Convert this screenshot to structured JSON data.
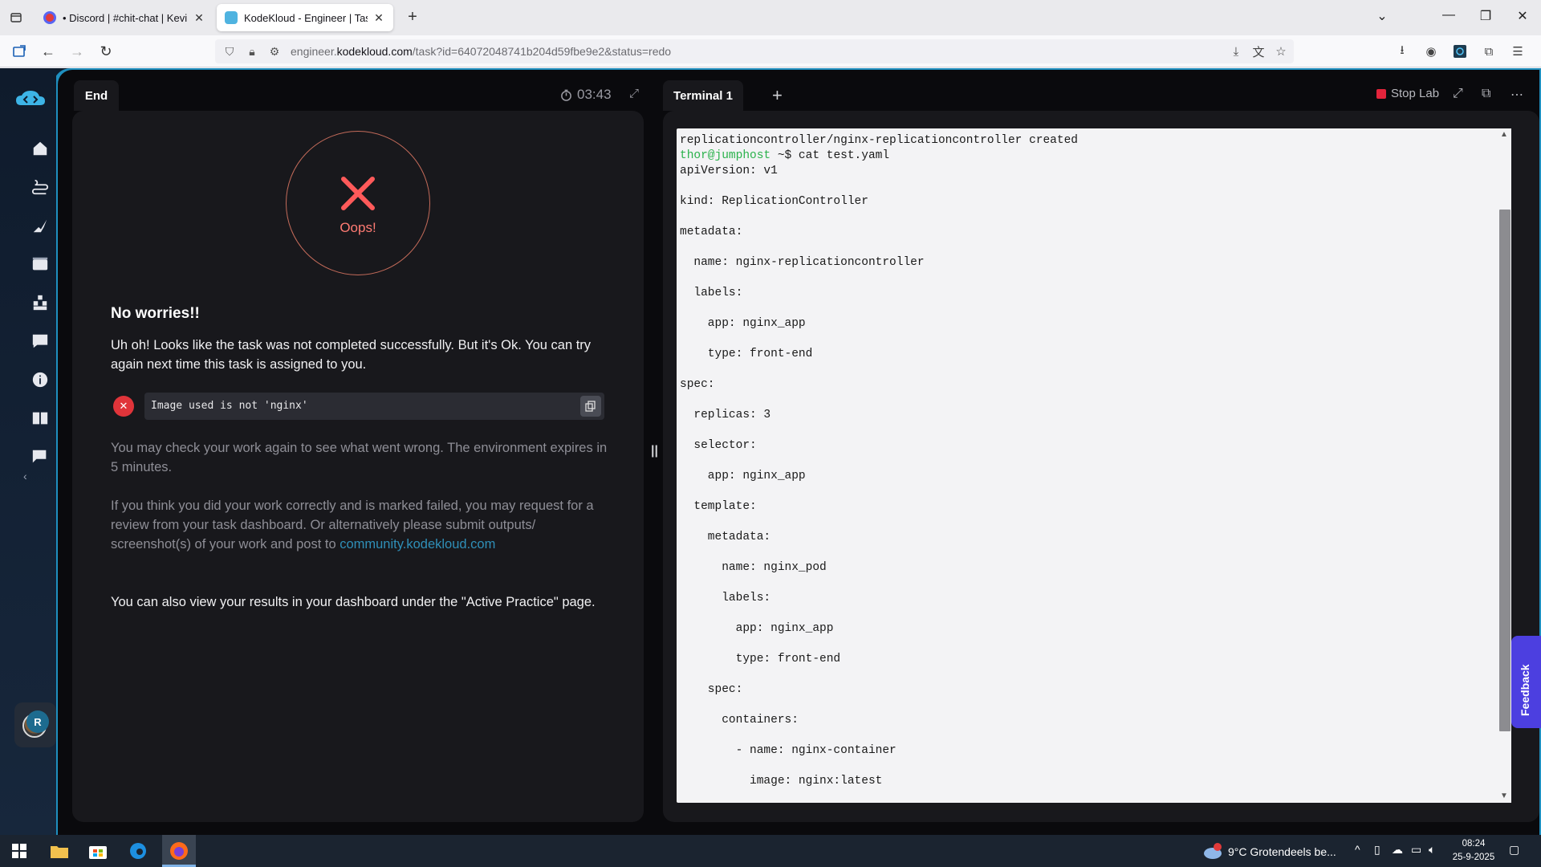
{
  "browser": {
    "tabs": [
      {
        "title": "• Discord | #chit-chat | Kevin Po",
        "active": false
      },
      {
        "title": "KodeKloud - Engineer | Task",
        "active": true
      }
    ],
    "url_prefix": "engineer.",
    "url_domain": "kodekloud.com",
    "url_path": "/task?id=64072048741b204d59fbe9e2&status=redo"
  },
  "left_panel": {
    "tab_label": "End",
    "timer": "03:43",
    "oops_label": "Oops!",
    "heading": "No worries!!",
    "message": "Uh oh! Looks like the task was not completed successfully. But it's Ok. You can try again next time this task is assigned to you.",
    "error_text": "Image used is not 'nginx'",
    "check_text": "You may check your work again to see what went wrong. The environment expires in 5 minutes.",
    "review_text": "If you think you did your work correctly and is marked failed, you may request for a review from your task dashboard. Or alternatively please submit outputs/ screenshot(s) of your work and post to ",
    "review_link": "community.kodekloud.com",
    "results_text": "You can also view your results in your dashboard under the \"Active Practice\" page."
  },
  "terminal": {
    "tab_label": "Terminal 1",
    "stop_label": "Stop Lab",
    "prompt_user": "thor@jumphost",
    "prompt_rest": " ~$ cat test.yaml",
    "lines": [
      "replicationcontroller/nginx-replicationcontroller created",
      "__PROMPT__",
      "apiVersion: v1",
      "",
      "kind: ReplicationController",
      "",
      "metadata:",
      "",
      "  name: nginx-replicationcontroller",
      "",
      "  labels:",
      "",
      "    app: nginx_app",
      "",
      "    type: front-end",
      "",
      "spec:",
      "",
      "  replicas: 3",
      "",
      "  selector:",
      "",
      "    app: nginx_app",
      "",
      "  template:",
      "",
      "    metadata:",
      "",
      "      name: nginx_pod",
      "",
      "      labels:",
      "",
      "        app: nginx_app",
      "",
      "        type: front-end",
      "",
      "    spec:",
      "",
      "      containers:",
      "",
      "        - name: nginx-container",
      "",
      "          image: nginx:latest"
    ]
  },
  "feedback_label": "Feedback",
  "sidebar": {
    "user_initial": "R",
    "icons": [
      "home-icon",
      "learning-path-icon",
      "playground-icon",
      "video-icon",
      "skills-icon",
      "forum-icon",
      "info-icon",
      "docs-icon",
      "chat-icon"
    ]
  },
  "taskbar": {
    "weather": "9°C  Grotendeels be...",
    "weather_badge": "1",
    "time": "08:24",
    "date": "25-9-2025"
  },
  "colors": {
    "accent": "#1f8fbf",
    "error": "#e0343a",
    "oops": "#ff7b73",
    "prompt": "#2bb24c",
    "feedback": "#4c3fe0"
  }
}
